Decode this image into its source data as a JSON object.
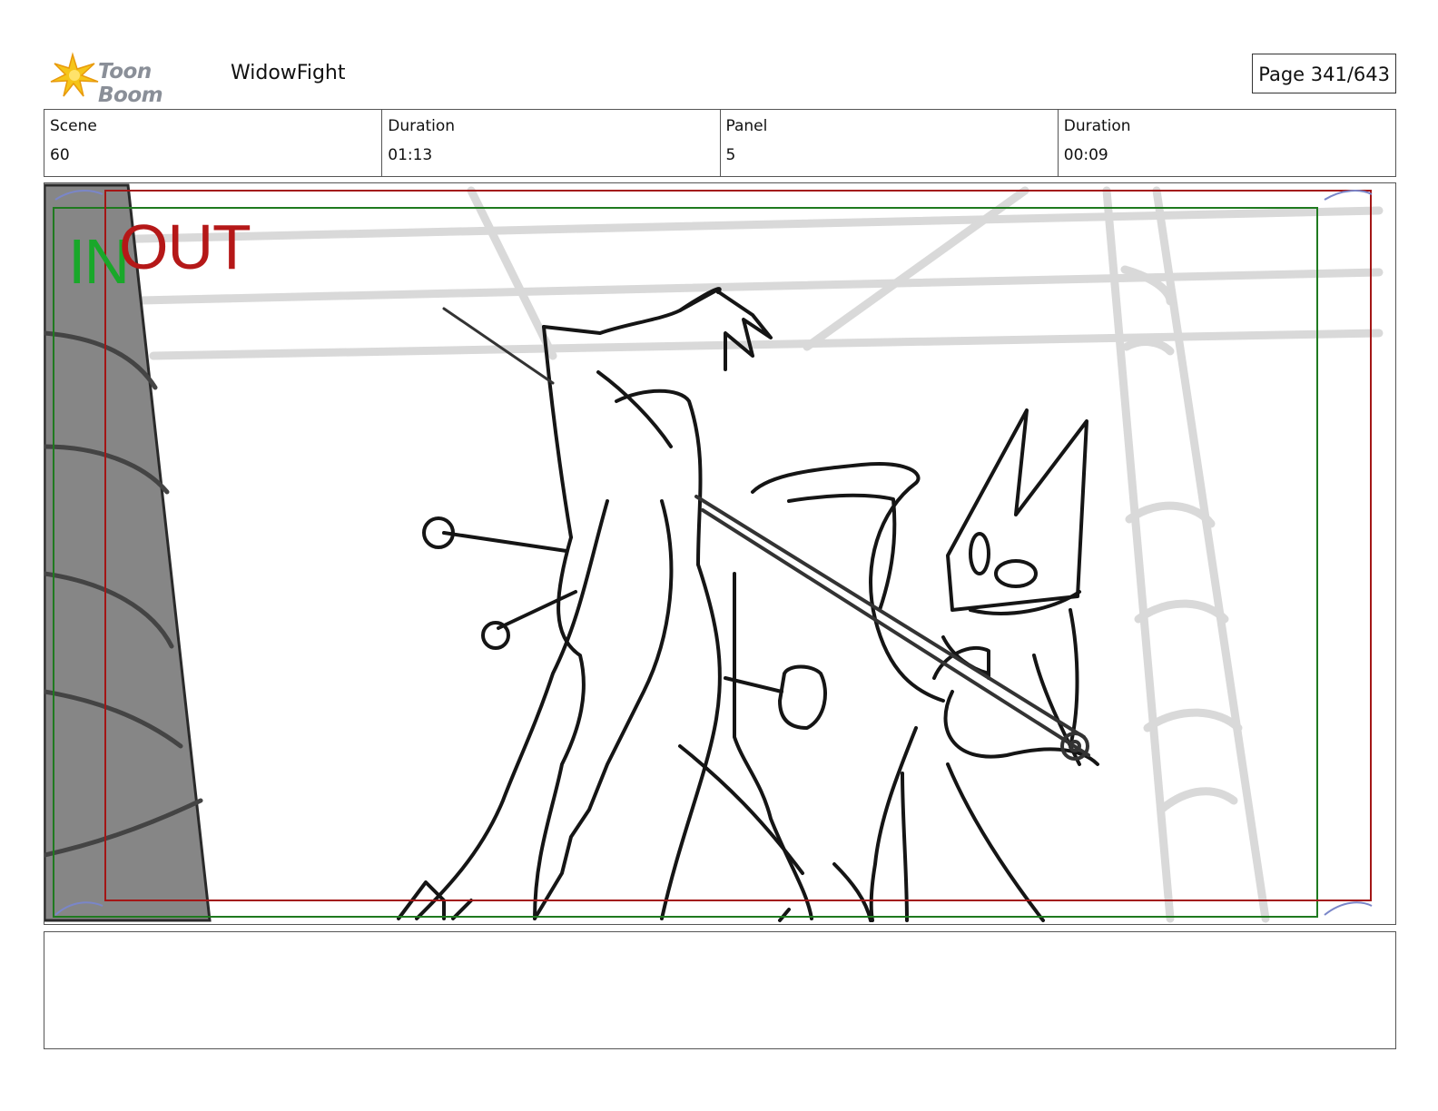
{
  "header": {
    "logo_text": "Toon Boom",
    "project_title": "WidowFight",
    "page_indicator": "Page 341/643"
  },
  "info": {
    "scene_label": "Scene",
    "scene_value": "60",
    "scene_duration_label": "Duration",
    "scene_duration_value": "01:13",
    "panel_label": "Panel",
    "panel_value": "5",
    "panel_duration_label": "Duration",
    "panel_duration_value": "00:09"
  },
  "panel": {
    "in_label": "IN",
    "out_label": "OUT",
    "in_color": "#19a82a",
    "out_color": "#b51818"
  },
  "notes": {
    "text": ""
  }
}
